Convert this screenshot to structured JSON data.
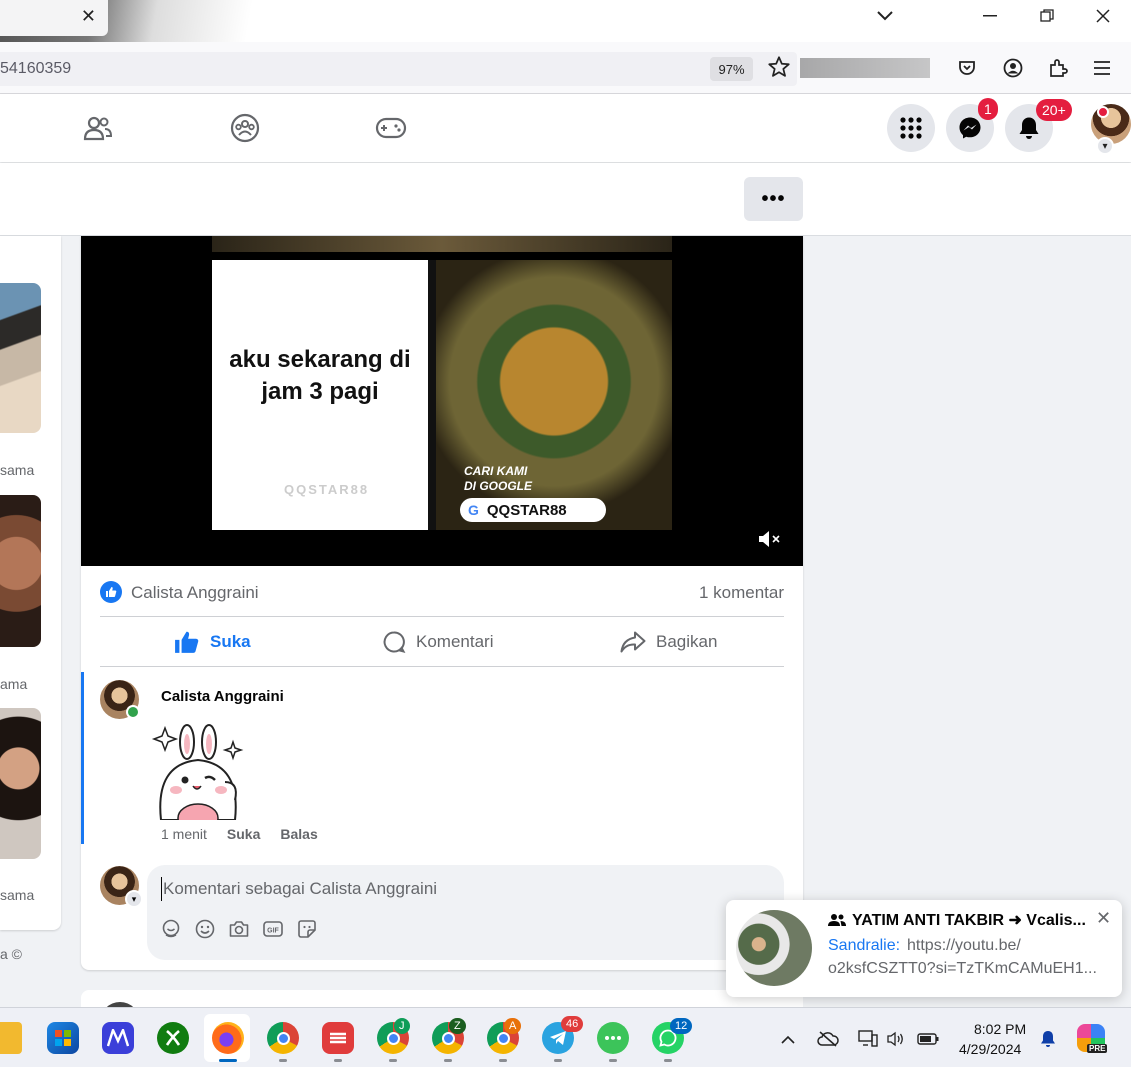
{
  "browser": {
    "url_fragment": "54160359",
    "zoom": "97%"
  },
  "fb_nav": {
    "messenger_badge": "1",
    "notifications_badge": "20+"
  },
  "video": {
    "caption": "aku sekarang di jam 3 pagi",
    "cari_line1": "CARI KAMI",
    "cari_line2": "DI GOOGLE",
    "search_term": "QQSTAR88"
  },
  "post": {
    "reactor_name": "Calista Anggraini",
    "comment_count": "1 komentar",
    "actions": {
      "like": "Suka",
      "comment": "Komentari",
      "share": "Bagikan"
    },
    "comment": {
      "author": "Calista Anggraini",
      "time": "1 menit",
      "like": "Suka",
      "reply": "Balas"
    },
    "compose_placeholder": "Komentari sebagai Calista Anggraini"
  },
  "left_column": {
    "captions": [
      "sama",
      "ama",
      "sama"
    ],
    "footer": "a ©"
  },
  "toast": {
    "title": "YATIM ANTI TAKBIR ➜ Vcalis...",
    "sender": "Sandralie:",
    "link_line1": "https://youtu.be/",
    "link_line2": "o2ksfCSZTT0?si=TzTKmCAMuEH1..."
  },
  "taskbar": {
    "telegram_badge": "46",
    "whatsapp_badge": "12",
    "chrome_profiles": [
      "J",
      "Z",
      "A"
    ],
    "time": "8:02 PM",
    "date": "4/29/2024",
    "copilot_label": "PRE"
  },
  "colors": {
    "fb_blue": "#1877f2",
    "badge_red": "#e41e3f",
    "online_green": "#31a24c"
  }
}
